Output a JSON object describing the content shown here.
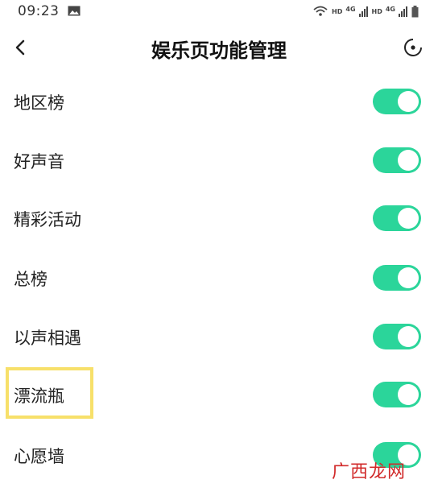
{
  "status_bar": {
    "time": "09:23",
    "hd1": "HD",
    "net1": "4G",
    "hd2": "HD",
    "net2": "4G",
    "icons": [
      "image-icon",
      "wifi-icon",
      "signal-icon",
      "signal-icon",
      "battery-icon"
    ]
  },
  "header": {
    "title": "娱乐页功能管理",
    "back_icon": "chevron-left-icon",
    "more_icon": "more-circle-icon"
  },
  "settings": [
    {
      "label": "地区榜",
      "enabled": true
    },
    {
      "label": "好声音",
      "enabled": true
    },
    {
      "label": "精彩活动",
      "enabled": true
    },
    {
      "label": "总榜",
      "enabled": true
    },
    {
      "label": "以声相遇",
      "enabled": true
    },
    {
      "label": "漂流瓶",
      "enabled": true
    },
    {
      "label": "心愿墙",
      "enabled": true
    }
  ],
  "colors": {
    "toggle_on": "#2bd59a",
    "highlight_box": "#f7e06a",
    "watermark": "#d12a2a"
  },
  "watermark": "广西龙网"
}
